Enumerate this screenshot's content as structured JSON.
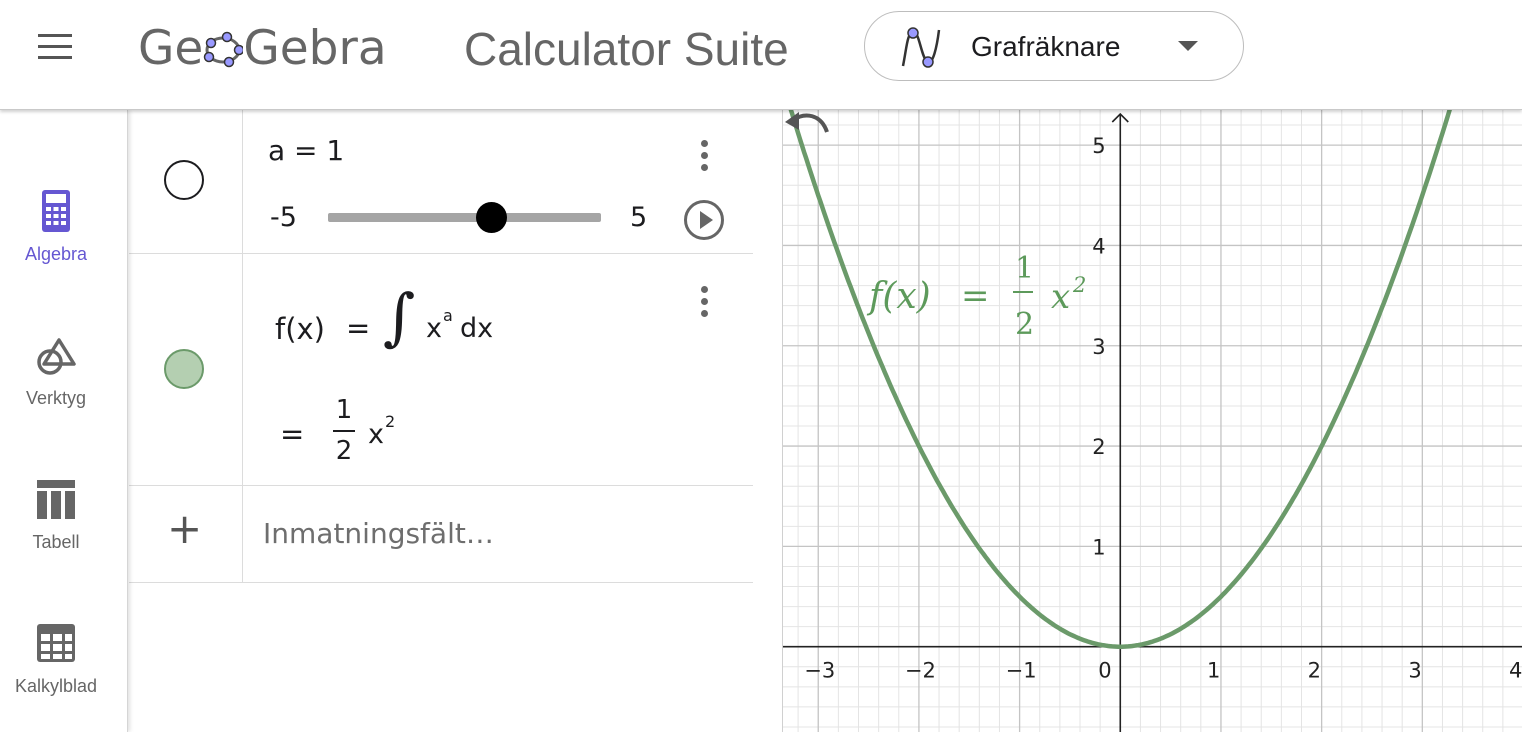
{
  "header": {
    "logo_text_left": "Ge",
    "logo_text_right": "Gebra",
    "suite_title": "Calculator Suite",
    "app_selector": {
      "label": "Grafräknare",
      "icon": "graphing-app-icon"
    }
  },
  "sidebar": {
    "items": [
      {
        "label": "Algebra",
        "icon": "calculator-icon",
        "active": true
      },
      {
        "label": "Verktyg",
        "icon": "tools-icon",
        "active": false
      },
      {
        "label": "Tabell",
        "icon": "table-icon",
        "active": false
      },
      {
        "label": "Kalkylblad",
        "icon": "spreadsheet-icon",
        "active": false
      }
    ],
    "active_color": "#6557d2"
  },
  "algebra_view": {
    "slider": {
      "definition": "a = 1",
      "min_label": "-5",
      "max_label": "5",
      "min": -5,
      "max": 5,
      "value": 1
    },
    "function": {
      "lhs": "f(x)",
      "equals": "=",
      "integral_sign": "∫",
      "integrand_base": "x",
      "integrand_exp": "a",
      "differential": "dx",
      "result_equals": "=",
      "result_numerator": "1",
      "result_denominator": "2",
      "result_base": "x",
      "result_exp": "2",
      "color": "#6b9a6a"
    },
    "input": {
      "placeholder": "Inmatningsfält…",
      "add_symbol": "+"
    }
  },
  "graphics_view": {
    "curve_label": {
      "lhs": "f(x)",
      "equals": "=",
      "numerator": "1",
      "denominator": "2",
      "base": "x",
      "exp": "2"
    },
    "x_ticks": [
      "−3",
      "−2",
      "−1",
      "0",
      "1",
      "2",
      "3",
      "4"
    ],
    "y_ticks": [
      "1",
      "2",
      "3",
      "4",
      "5"
    ],
    "curve_color": "#6b9a6a"
  },
  "chart_data": {
    "type": "line",
    "title": "",
    "xlabel": "",
    "ylabel": "",
    "xlim": [
      -3.35,
      4.0
    ],
    "ylim": [
      -0.85,
      5.35
    ],
    "grid": true,
    "series": [
      {
        "name": "f(x) = 1/2 x²",
        "x": [
          -3.3,
          -3.0,
          -2.5,
          -2.0,
          -1.5,
          -1.0,
          -0.5,
          0.0,
          0.5,
          1.0,
          1.5,
          2.0,
          2.5,
          3.0,
          3.3
        ],
        "y": [
          5.445,
          4.5,
          3.125,
          2.0,
          1.125,
          0.5,
          0.125,
          0.0,
          0.125,
          0.5,
          1.125,
          2.0,
          3.125,
          4.5,
          5.445
        ]
      }
    ]
  }
}
